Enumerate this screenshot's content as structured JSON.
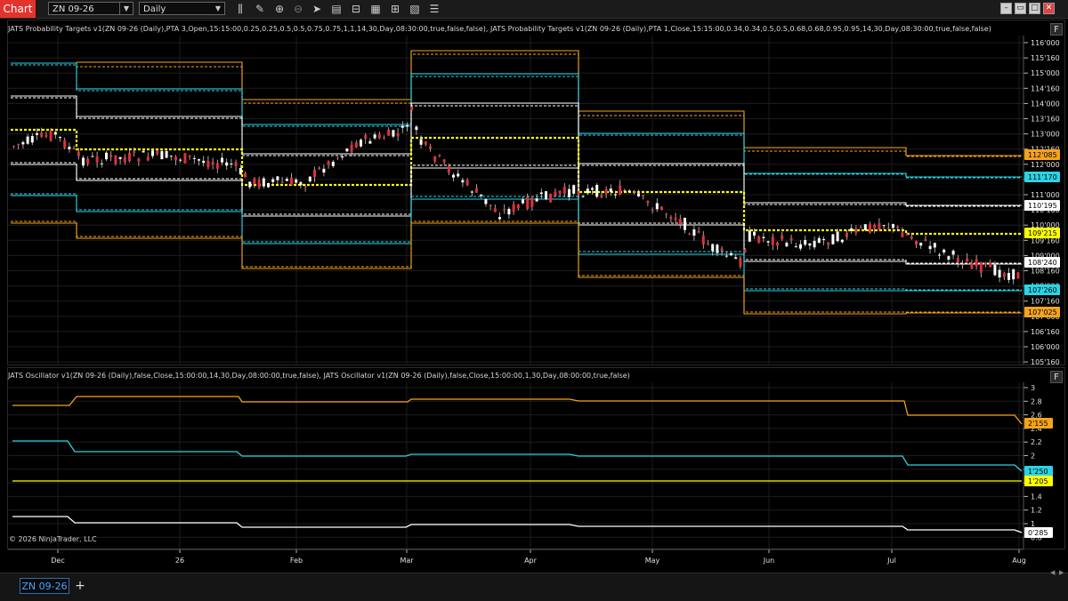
{
  "toolbar": {
    "chart_label": "Chart",
    "instrument": "ZN 09-26",
    "period": "Daily",
    "icons": [
      "bar-type-icon",
      "draw-pencil-icon",
      "zoom-in-icon",
      "zoom-out-icon",
      "pointer-icon",
      "data-box-icon",
      "chart-trader-icon",
      "strategies-icon",
      "properties-icon",
      "indicators-icon"
    ],
    "window_buttons": [
      "minimize",
      "restore",
      "maximize",
      "close"
    ]
  },
  "price_panel": {
    "indicator_label": "JATS Probability Targets v1(ZN 09-26 (Daily),PTA 3,Open,15:15:00,0.25,0.25,0.5,0.5,0.75,0.75,1,1,14,30,Day,08:30:00,true,false,false), JATS Probability Targets v1(ZN 09-26 (Daily),PTA 1,Close,15:15:00,0.34,0.34,0.5,0.5,0.68,0.68,0.95,0.95,14,30,Day,08:30:00,true,false,false)",
    "f_label": "F",
    "y_ticks": [
      "116'000",
      "115'160",
      "115'000",
      "114'160",
      "114'000",
      "113'160",
      "113'000",
      "112'160",
      "112'000",
      "111'160",
      "111'000",
      "110'160",
      "110'000",
      "109'160",
      "109'000",
      "108'160",
      "108'000",
      "107'160",
      "107'000",
      "106'160",
      "106'000",
      "105'160"
    ],
    "markers": [
      {
        "label": "112'085",
        "color": "#f5a31a",
        "text_color": "#000000"
      },
      {
        "label": "111'170",
        "color": "#2ad4e6",
        "text_color": "#000000"
      },
      {
        "label": "110'195",
        "color": "#ffffff",
        "text_color": "#000000"
      },
      {
        "label": "109'215",
        "color": "#ffff00",
        "text_color": "#000000"
      },
      {
        "label": "108'240",
        "color": "#ffffff",
        "text_color": "#000000"
      },
      {
        "label": "107'260",
        "color": "#2ad4e6",
        "text_color": "#000000"
      },
      {
        "label": "107'025",
        "color": "#f5a31a",
        "text_color": "#000000"
      }
    ]
  },
  "osc_panel": {
    "indicator_label": "JATS Oscillator v1(ZN 09-26 (Daily),false,Close,15:00:00,14,30,Day,08:00:00,true,false), JATS Oscillator v1(ZN 09-26 (Daily),false,Close,15:00:00,1,30,Day,08:00:00,true,false)",
    "f_label": "F",
    "y_ticks": [
      "3",
      "2.8",
      "2.6",
      "2.4",
      "2.2",
      "2",
      "1.8",
      "1.6",
      "1.4",
      "1.2",
      "1",
      "0.8"
    ],
    "markers": [
      {
        "label": "2'155",
        "color": "#f5a31a",
        "text_color": "#000000"
      },
      {
        "label": "1'250",
        "color": "#2ad4e6",
        "text_color": "#000000"
      },
      {
        "label": "1'205",
        "color": "#ffff00",
        "text_color": "#000000"
      },
      {
        "label": "0'285",
        "color": "#ffffff",
        "text_color": "#000000"
      }
    ],
    "copyright": "© 2026 NinjaTrader, LLC"
  },
  "x_axis": {
    "labels": [
      "Dec",
      "26",
      "Feb",
      "Mar",
      "Apr",
      "May",
      "Jun",
      "Jul",
      "Aug"
    ]
  },
  "tabs": {
    "active": "ZN 09-26",
    "add": "+"
  },
  "colors": {
    "orange": "#f5a31a",
    "cyan": "#2ad4e6",
    "white": "#ffffff",
    "yellow": "#ffff00",
    "up_candle": "#ffffff",
    "down_candle": "#e0303a",
    "chart_button": "#e3332e"
  }
}
